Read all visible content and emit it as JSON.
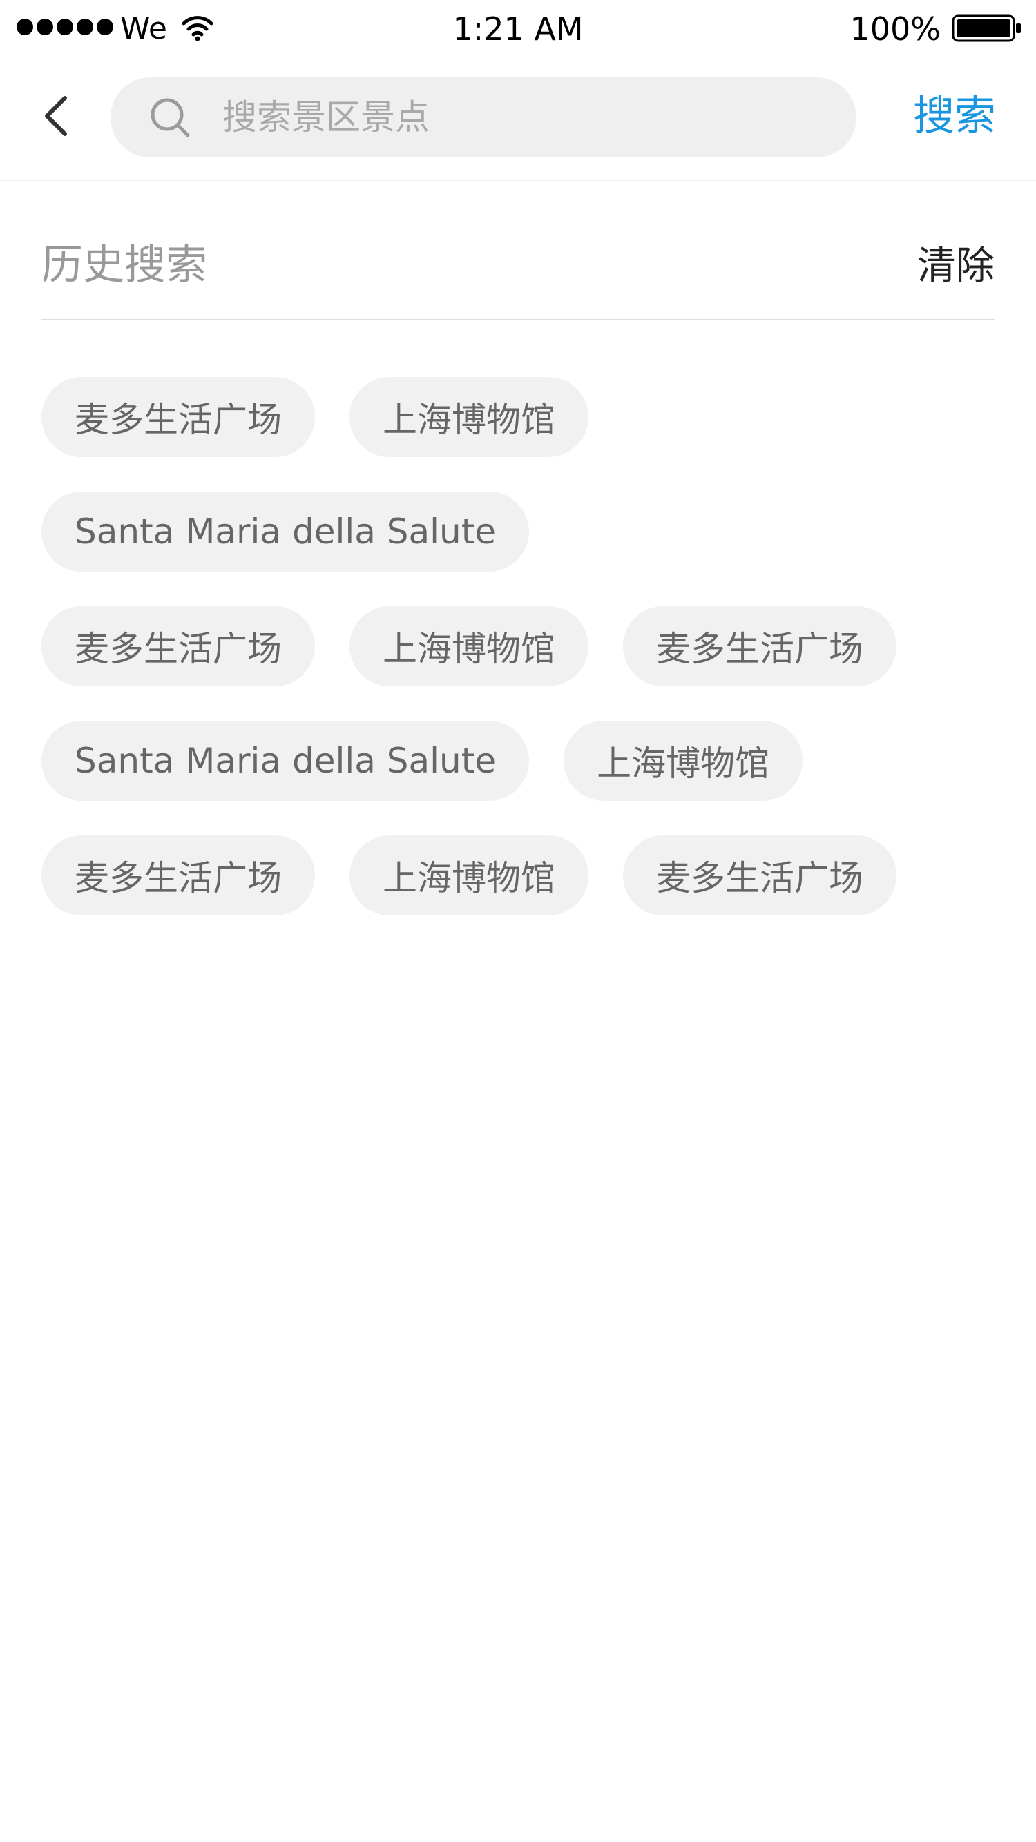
{
  "status_bar": {
    "carrier": "We",
    "time": "1:21 AM",
    "battery": "100%"
  },
  "nav": {
    "search_placeholder": "搜索景区景点",
    "search_value": "",
    "search_button": "搜索"
  },
  "history": {
    "title": "历史搜索",
    "clear_label": "清除",
    "rows": [
      [
        "麦多生活广场",
        "上海博物馆"
      ],
      [
        "Santa Maria della Salute"
      ],
      [
        "麦多生活广场",
        "上海博物馆",
        "麦多生活广场"
      ],
      [
        "Santa Maria della Salute",
        "上海博物馆"
      ],
      [
        "麦多生活广场",
        "上海博物馆",
        "麦多生活广场"
      ]
    ]
  },
  "colors": {
    "accent": "#1a96e0",
    "tag_background": "#f1f1f1",
    "tag_text": "#666666",
    "muted_text": "#999999"
  },
  "icons": {
    "back": "chevron-left-icon",
    "search": "search-icon",
    "wifi": "wifi-icon",
    "battery": "battery-icon"
  }
}
